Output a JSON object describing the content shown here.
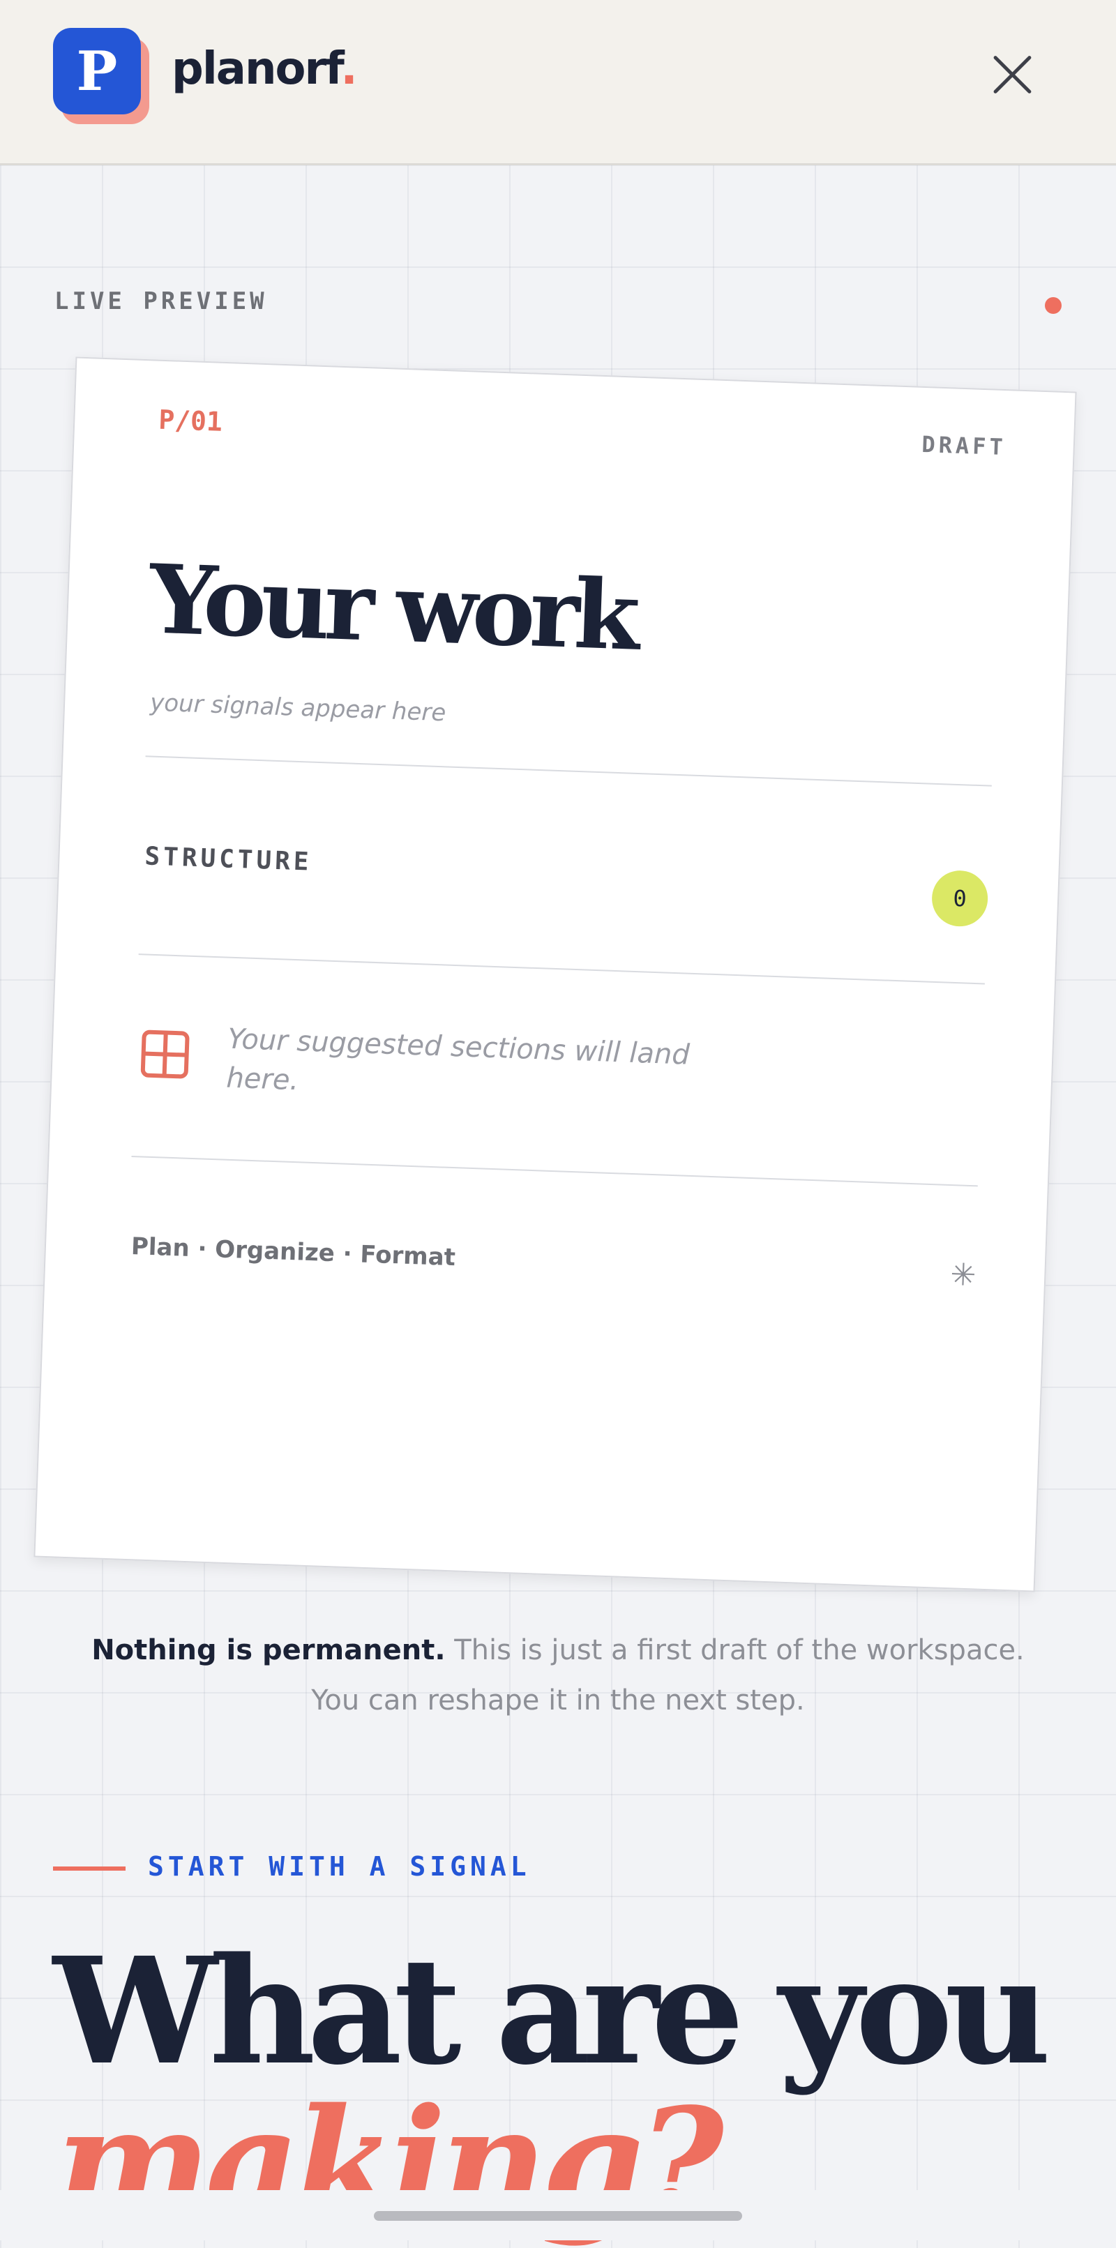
{
  "header": {
    "logo_letter": "P",
    "brand_name": "planorf",
    "brand_dot": ".",
    "close_icon": "close-icon"
  },
  "preview": {
    "label": "LIVE PREVIEW",
    "status_dot_color": "#ee6f5f"
  },
  "card": {
    "id": "P/01",
    "status": "DRAFT",
    "title": "Your work",
    "subtitle": "your signals appear here",
    "structure_label": "STRUCTURE",
    "structure_count": "0",
    "empty_icon": "grid-icon",
    "empty_text": "Your suggested sections will land here.",
    "footer_tags": "Plan · Organize · Format",
    "footer_icon": "asterisk-icon",
    "footer_glyph": "✳"
  },
  "note": {
    "strong": "Nothing is permanent.",
    "rest": " This is just a first draft of the workspace. You can reshape it in the next step."
  },
  "signal": {
    "label": "START WITH A SIGNAL",
    "headline": "What are you",
    "headline_accent": "making?"
  },
  "colors": {
    "brand_blue": "#2456d6",
    "accent_coral": "#ee6f5f",
    "count_badge": "#dbe865",
    "ink": "#1b2236"
  }
}
